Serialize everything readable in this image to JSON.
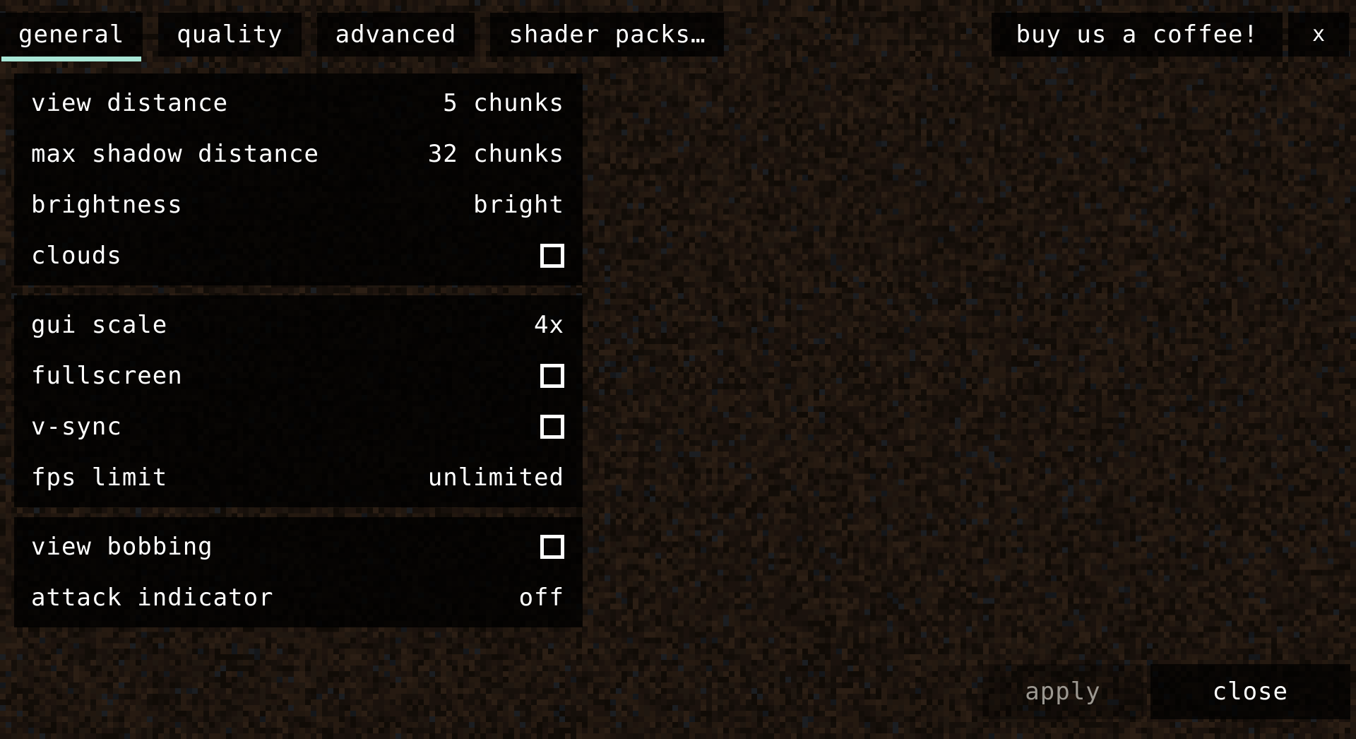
{
  "colors": {
    "background_dirt_base": "#231812",
    "background_dirt_light": "#3a2a1e",
    "background_dirt_dark": "#140d09",
    "panel_overlay": "#000000",
    "text_primary": "#ffffff",
    "text_disabled": "#9c9891",
    "accent_underline": "#a9e6d6"
  },
  "header": {
    "tabs": [
      {
        "label": "general",
        "active": true
      },
      {
        "label": "quality",
        "active": false
      },
      {
        "label": "advanced",
        "active": false
      },
      {
        "label": "shader packs…",
        "active": false
      }
    ],
    "coffee_button": {
      "label": "buy us a coffee!"
    },
    "close_x_button": {
      "label": "x",
      "icon": "close-icon"
    }
  },
  "options": {
    "groups": [
      {
        "name": "render-group",
        "rows": [
          {
            "label": "view distance",
            "type": "value",
            "value": "5 chunks"
          },
          {
            "label": "max shadow distance",
            "type": "value",
            "value": "32 chunks"
          },
          {
            "label": "brightness",
            "type": "value",
            "value": "bright"
          },
          {
            "label": "clouds",
            "type": "checkbox",
            "checked": false
          }
        ]
      },
      {
        "name": "window-group",
        "rows": [
          {
            "label": "gui scale",
            "type": "value",
            "value": "4x"
          },
          {
            "label": "fullscreen",
            "type": "checkbox",
            "checked": false
          },
          {
            "label": "v-sync",
            "type": "checkbox",
            "checked": false
          },
          {
            "label": "fps limit",
            "type": "value",
            "value": "unlimited"
          }
        ]
      },
      {
        "name": "gameplay-group",
        "rows": [
          {
            "label": "view bobbing",
            "type": "checkbox",
            "checked": false
          },
          {
            "label": "attack indicator",
            "type": "value",
            "value": "off"
          }
        ]
      }
    ]
  },
  "footer": {
    "apply_button": {
      "label": "apply",
      "disabled": true
    },
    "close_button": {
      "label": "close",
      "disabled": false
    }
  }
}
